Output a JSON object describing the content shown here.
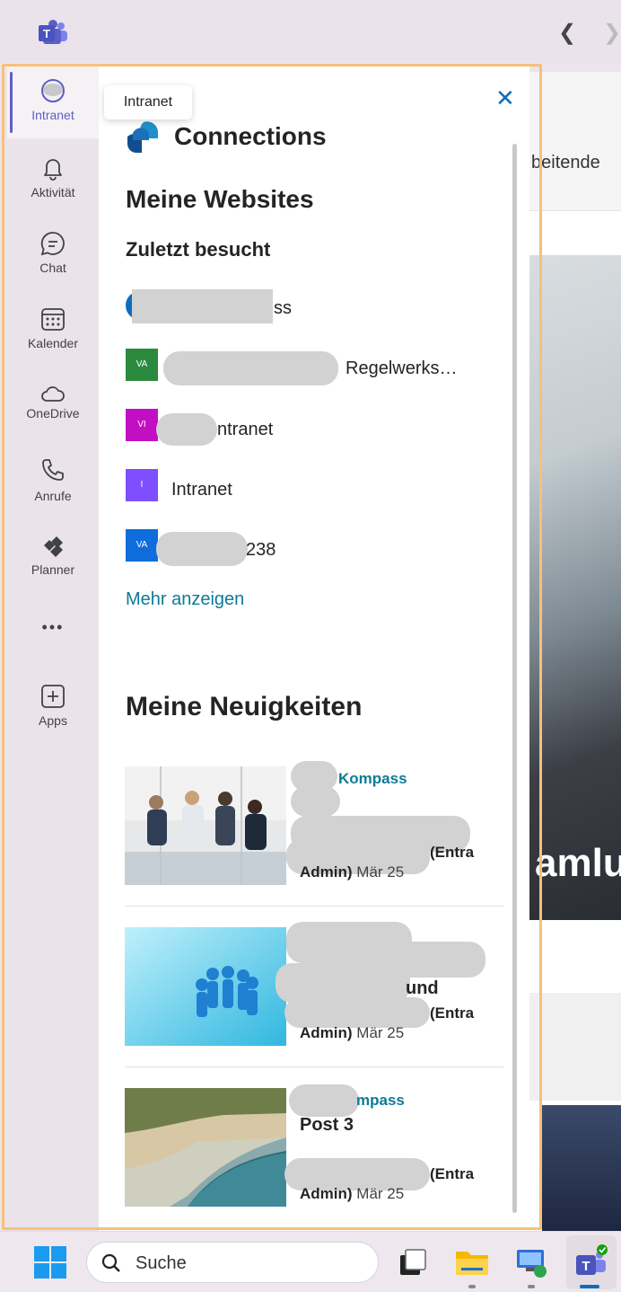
{
  "titlebar": {
    "back_icon": "chevron-left-icon",
    "forward_icon": "chevron-right-icon"
  },
  "rail": {
    "items": [
      {
        "label": "Intranet",
        "icon": "intranet-icon",
        "active": true
      },
      {
        "label": "Aktivität",
        "icon": "bell-icon"
      },
      {
        "label": "Chat",
        "icon": "chat-icon"
      },
      {
        "label": "Kalender",
        "icon": "calendar-icon"
      },
      {
        "label": "OneDrive",
        "icon": "cloud-icon"
      },
      {
        "label": "Anrufe",
        "icon": "phone-icon"
      },
      {
        "label": "Planner",
        "icon": "planner-icon"
      },
      {
        "label": "•••",
        "icon": "more-icon"
      },
      {
        "label": "Apps",
        "icon": "add-apps-icon"
      }
    ],
    "active_color": "#5b5fc7"
  },
  "tooltip": "Intranet",
  "panel": {
    "app_title": "Connections",
    "my_sites_heading": "Meine Websites",
    "recent_heading": "Zuletzt besucht",
    "sites": [
      {
        "badge": "",
        "name": "ss",
        "badge_color": "#0f6cbd"
      },
      {
        "badge": "VA",
        "name": "Regelwerks…",
        "badge_color": "#2b8a3e"
      },
      {
        "badge": "VI",
        "name": "ntranet",
        "badge_color": "#c30fc3"
      },
      {
        "badge": "I",
        "name": "Intranet",
        "badge_color": "#7f4fff"
      },
      {
        "badge": "VA",
        "name": "238",
        "badge_color": "#0f6cdb"
      }
    ],
    "more_link": "Mehr anzeigen",
    "news_heading": "Meine Neuigkeiten",
    "news": [
      {
        "site": "Kompass",
        "title": "",
        "entra": "(Entra",
        "author": "Admin)",
        "date": "Mär 25"
      },
      {
        "site": "",
        "title": "und",
        "entra": "(Entra",
        "author": "Admin)",
        "date": "Mär 25"
      },
      {
        "site": "mpass",
        "title": "Post 3",
        "entra": "(Entra",
        "author": "Admin)",
        "date": "Mär 25"
      }
    ]
  },
  "background": {
    "header_text": "beitende",
    "banner_text": "amlur"
  },
  "taskbar": {
    "search_placeholder": "Suche"
  }
}
